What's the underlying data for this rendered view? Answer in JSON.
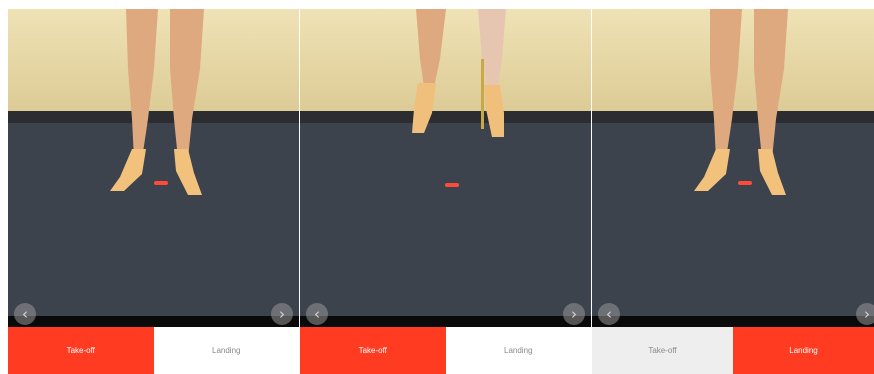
{
  "panels": [
    {
      "id": "frame-1",
      "pose": "en-pointe",
      "buttons": {
        "takeoff": "Take-off",
        "landing": "Landing"
      },
      "selected": "takeoff",
      "prev_icon": "chevron-left-icon",
      "next_icon": "chevron-right-icon"
    },
    {
      "id": "frame-2",
      "pose": "airborne",
      "buttons": {
        "takeoff": "Take-off",
        "landing": "Landing"
      },
      "selected": "takeoff",
      "prev_icon": "chevron-left-icon",
      "next_icon": "chevron-right-icon"
    },
    {
      "id": "frame-3",
      "pose": "en-pointe",
      "buttons": {
        "takeoff": "Take-off",
        "landing": "Landing"
      },
      "selected": "landing",
      "prev_icon": "chevron-left-icon",
      "next_icon": "chevron-right-icon"
    }
  ],
  "colors": {
    "accent": "#ff3b22",
    "wall": "#e8d9a8",
    "floor": "#3e444e",
    "skin": "#dfa97f",
    "shoe": "#f0c07e",
    "marker": "#ff4a3a"
  }
}
